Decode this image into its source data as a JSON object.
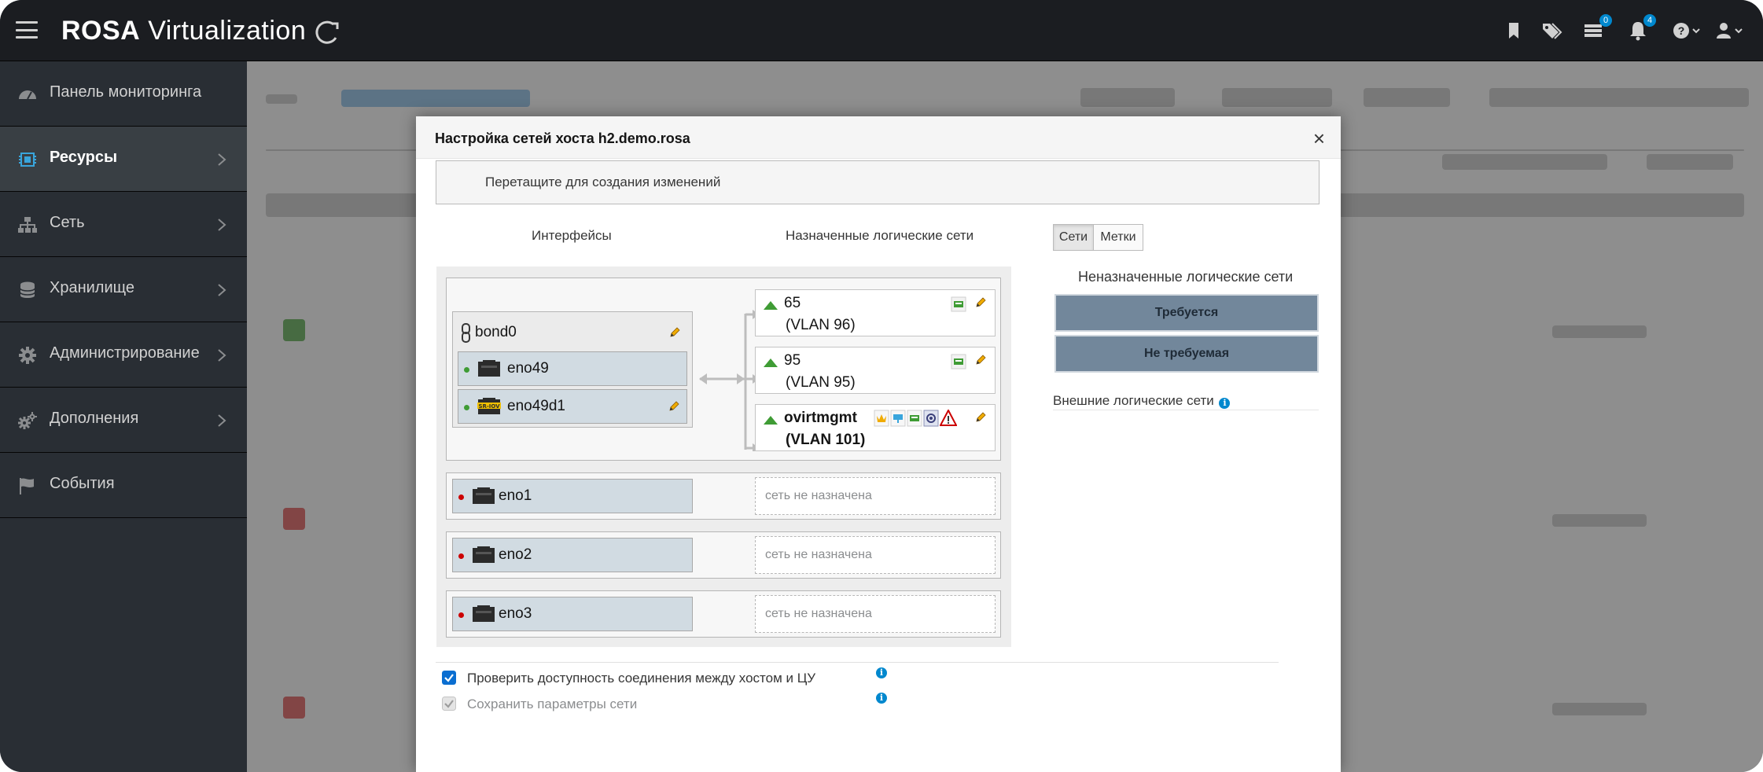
{
  "app": {
    "brand_bold": "ROSA",
    "brand_light": "Virtualization"
  },
  "topbar": {
    "icons": [
      "bookmark-icon",
      "tags-icon",
      "tasks-icon",
      "bell-icon",
      "help-icon",
      "user-icon"
    ],
    "tasks_badge": "0",
    "notifications_badge": "4"
  },
  "sidebar": {
    "items": [
      {
        "label": "Панель мониторинга",
        "icon": "dashboard-icon"
      },
      {
        "label": "Ресурсы",
        "icon": "cpu-icon"
      },
      {
        "label": "Сеть",
        "icon": "network-icon"
      },
      {
        "label": "Хранилище",
        "icon": "database-icon"
      },
      {
        "label": "Администрирование",
        "icon": "gear-icon"
      },
      {
        "label": "Дополнения",
        "icon": "gears-icon"
      },
      {
        "label": "События",
        "icon": "flag-icon"
      }
    ]
  },
  "modal": {
    "title": "Настройка сетей хоста h2.demo.rosa",
    "close": "×",
    "drag_hint": "Перетащите для создания изменений",
    "col_interfaces": "Интерфейсы",
    "col_assigned": "Назначенные логические сети",
    "tabs": {
      "networks": "Сети",
      "labels": "Метки"
    },
    "unassigned_title": "Неназначенные логические сети",
    "required": "Требуется",
    "not_required": "Не требуемая",
    "external": "Внешние логические сети",
    "bond": {
      "name": "bond0",
      "slaves": [
        {
          "name": "eno49",
          "status": "up"
        },
        {
          "name": "eno49d1",
          "status": "up"
        }
      ],
      "networks": [
        {
          "name": "65",
          "vlan": "(VLAN 96)"
        },
        {
          "name": "95",
          "vlan": "(VLAN 95)"
        },
        {
          "name": "ovirtmgmt",
          "vlan": "(VLAN 101)"
        }
      ]
    },
    "nics": [
      {
        "name": "eno1",
        "status": "down",
        "network": "сеть не назначена"
      },
      {
        "name": "eno2",
        "status": "down",
        "network": "сеть не назначена"
      },
      {
        "name": "eno3",
        "status": "down",
        "network": "сеть не назначена"
      }
    ],
    "check_connectivity": "Проверить доступность соединения между хостом и ЦУ",
    "save_config": "Сохранить параметры сети"
  },
  "colors": {
    "up": "#3f9c35",
    "down": "#cc0000",
    "accent": "#0088ce"
  }
}
